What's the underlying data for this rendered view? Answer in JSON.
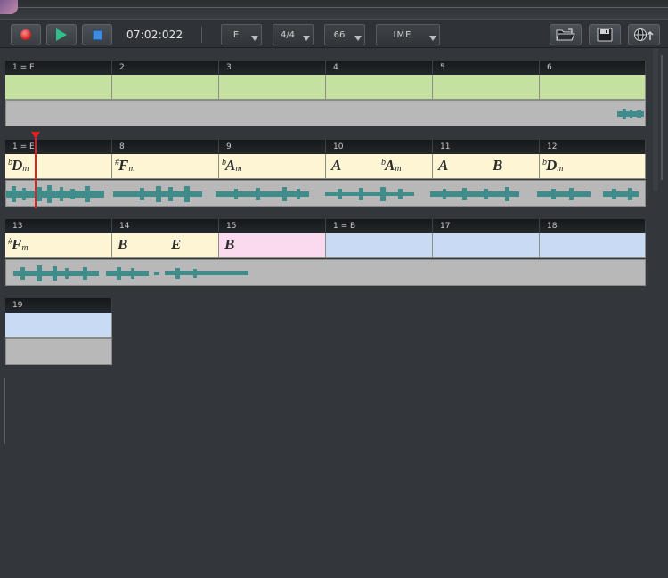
{
  "toolbar": {
    "time": "07:02:022",
    "key_select": "E",
    "meter_select": "4/4",
    "tempo_select": "66",
    "ime_select": "IME"
  },
  "colors": {
    "green_cell": "#c5e1a0",
    "cream_cell": "#fdf5d4",
    "pink_cell": "#fbdaf0",
    "blue_cell": "#c9daf4",
    "waveform": "#3f8c8a",
    "cursor": "#e02020"
  },
  "rows": [
    {
      "measures": [
        "1 = E",
        "2",
        "3",
        "4",
        "5",
        "6"
      ]
    },
    {
      "measures": [
        "1 = E",
        "8",
        "9",
        "10",
        "11",
        "12"
      ]
    },
    {
      "measures": [
        "13",
        "14",
        "15",
        "1 = B",
        "17",
        "18"
      ]
    },
    {
      "measures": [
        "19"
      ]
    }
  ],
  "chords": {
    "m7": {
      "acc": "b",
      "root": "D",
      "qual": "m"
    },
    "m8": {
      "acc": "#",
      "root": "F",
      "qual": "m"
    },
    "m9": {
      "acc": "b",
      "root": "A",
      "qual": "m"
    },
    "m10a": {
      "root": "A"
    },
    "m10b": {
      "acc": "b",
      "root": "A",
      "qual": "m"
    },
    "m11a": {
      "root": "A"
    },
    "m11b": {
      "root": "B"
    },
    "m12": {
      "acc": "b",
      "root": "D",
      "qual": "m"
    },
    "m13": {
      "acc": "#",
      "root": "F",
      "qual": "m"
    },
    "m14a": {
      "root": "B"
    },
    "m14b": {
      "root": "E"
    },
    "m15": {
      "root": "B"
    }
  }
}
